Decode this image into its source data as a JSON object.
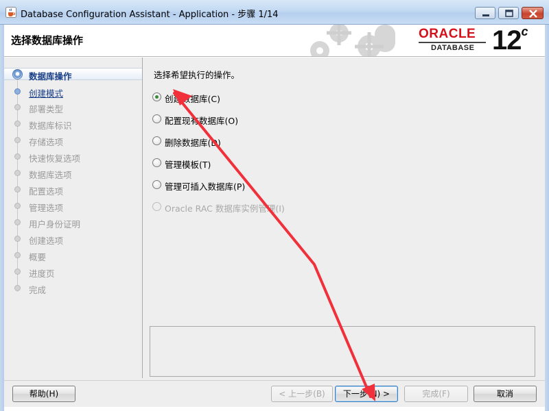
{
  "window": {
    "title": "Database Configuration Assistant - Application - 步骤 1/14",
    "controls": [
      "minimize-icon",
      "maximize-icon",
      "close-icon"
    ]
  },
  "banner": {
    "step_title": "选择数据库操作",
    "logo_word": "ORACLE",
    "logo_sub": "DATABASE",
    "version": "12",
    "version_suffix": "c"
  },
  "nav": {
    "items": [
      {
        "label": "数据库操作",
        "state": "current"
      },
      {
        "label": "创建模式",
        "state": "link"
      },
      {
        "label": "部署类型",
        "state": "disabled"
      },
      {
        "label": "数据库标识",
        "state": "disabled"
      },
      {
        "label": "存储选项",
        "state": "disabled"
      },
      {
        "label": "快速恢复选项",
        "state": "disabled"
      },
      {
        "label": "数据库选项",
        "state": "disabled"
      },
      {
        "label": "配置选项",
        "state": "disabled"
      },
      {
        "label": "管理选项",
        "state": "disabled"
      },
      {
        "label": "用户身份证明",
        "state": "disabled"
      },
      {
        "label": "创建选项",
        "state": "disabled"
      },
      {
        "label": "概要",
        "state": "disabled"
      },
      {
        "label": "进度页",
        "state": "disabled"
      },
      {
        "label": "完成",
        "state": "disabled"
      }
    ]
  },
  "main": {
    "prompt": "选择希望执行的操作。",
    "options": [
      {
        "label": "创建数据库(C)",
        "checked": true,
        "enabled": true
      },
      {
        "label": "配置现有数据库(O)",
        "checked": false,
        "enabled": true
      },
      {
        "label": "删除数据库(D)",
        "checked": false,
        "enabled": true
      },
      {
        "label": "管理模板(T)",
        "checked": false,
        "enabled": true
      },
      {
        "label": "管理可插入数据库(P)",
        "checked": false,
        "enabled": true
      },
      {
        "label": "Oracle RAC 数据库实例管理(I)",
        "checked": false,
        "enabled": false
      }
    ]
  },
  "buttons": {
    "help": "帮助(H)",
    "back": "< 上一步(B)",
    "next": "下一步(N) >",
    "finish": "完成(F)",
    "cancel": "取消"
  },
  "colors": {
    "accent": "#1a3f86",
    "oracle_red": "#d4101b",
    "annotation": "#f0303a"
  }
}
